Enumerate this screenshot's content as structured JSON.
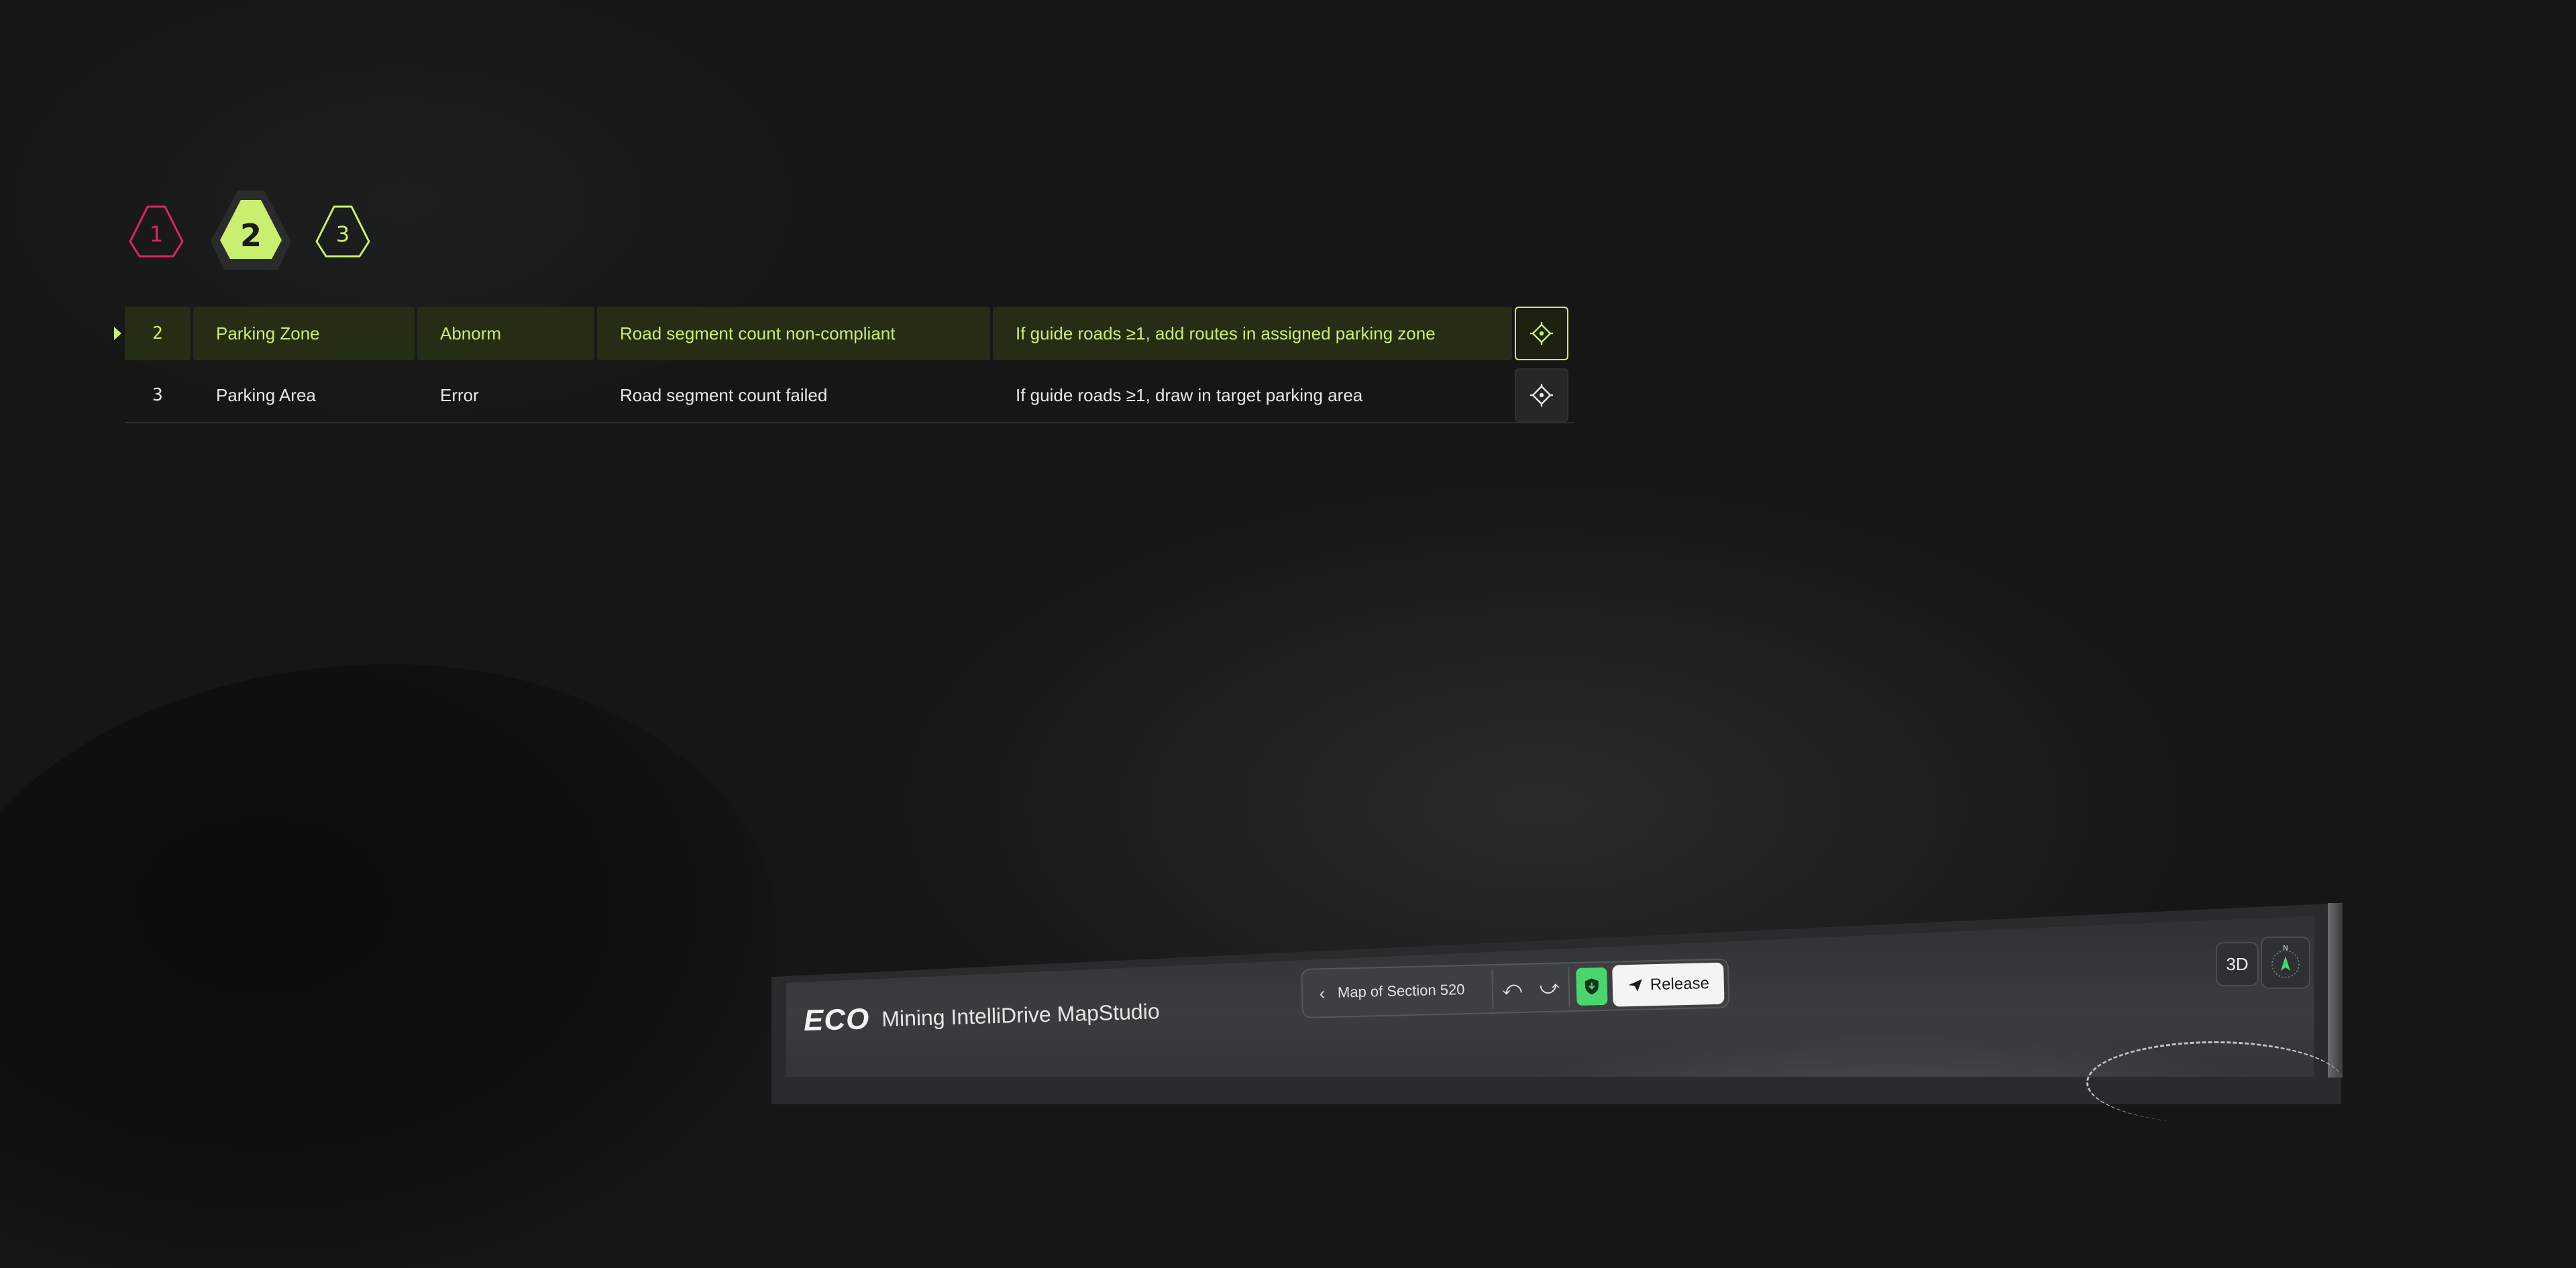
{
  "steps": [
    {
      "number": "1",
      "state": "error",
      "color": "#e0245e"
    },
    {
      "number": "2",
      "state": "current",
      "color": "#c9ef6e"
    },
    {
      "number": "3",
      "state": "pending",
      "color": "#c9ef6e"
    }
  ],
  "table": {
    "rows": [
      {
        "index": "2",
        "type": "Parking Zone",
        "level": "Abnorm",
        "description": "Road segment count non-compliant",
        "suggestion": "If guide roads ≥1, add routes in assigned parking zone",
        "active": true
      },
      {
        "index": "3",
        "type": "Parking Area",
        "level": "Error",
        "description": "Road segment count failed",
        "suggestion": "If guide roads ≥1, draw in target parking area",
        "active": false
      }
    ]
  },
  "app": {
    "logo": "ECO",
    "title": "Mining IntelliDrive MapStudio"
  },
  "toolbar": {
    "map_name": "Map of Section 520",
    "release_label": "Release"
  },
  "view": {
    "mode_label": "3D",
    "compass_north": "N"
  },
  "colors": {
    "accent": "#c9ef6e",
    "error": "#e0245e",
    "safe": "#4ad66d"
  }
}
